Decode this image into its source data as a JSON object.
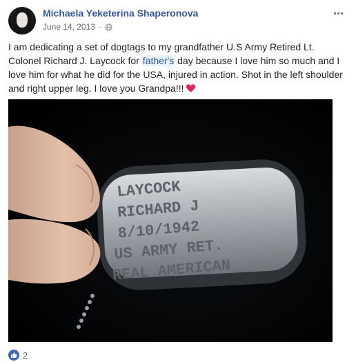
{
  "post": {
    "author": "Michaela Yeketerina Shaperonova",
    "date": "June 14, 2013",
    "separator": "·",
    "audience_icon": "globe-icon",
    "text_before": "I am dedicating a set of dogtags to my grandfather U.S Army Retired Lt. Colonel Richard J. Laycock for ",
    "link_text": "father's",
    "text_after": " day because I love him so much and I love him for what he did for the USA, injured in action. Shot in the left shoulder and right upper leg. I love you Grandpa!!!",
    "emoji": "heart-icon",
    "photo": {
      "tag_lines": [
        "LAYCOCK",
        "RICHARD J",
        "8/10/1942",
        "US ARMY RET.",
        "REAL AMERICAN"
      ]
    }
  },
  "reactions": {
    "icon": "like-icon",
    "count": "2"
  },
  "colors": {
    "link": "#365899",
    "like": "#4267b2",
    "heart": "#e0245e"
  }
}
